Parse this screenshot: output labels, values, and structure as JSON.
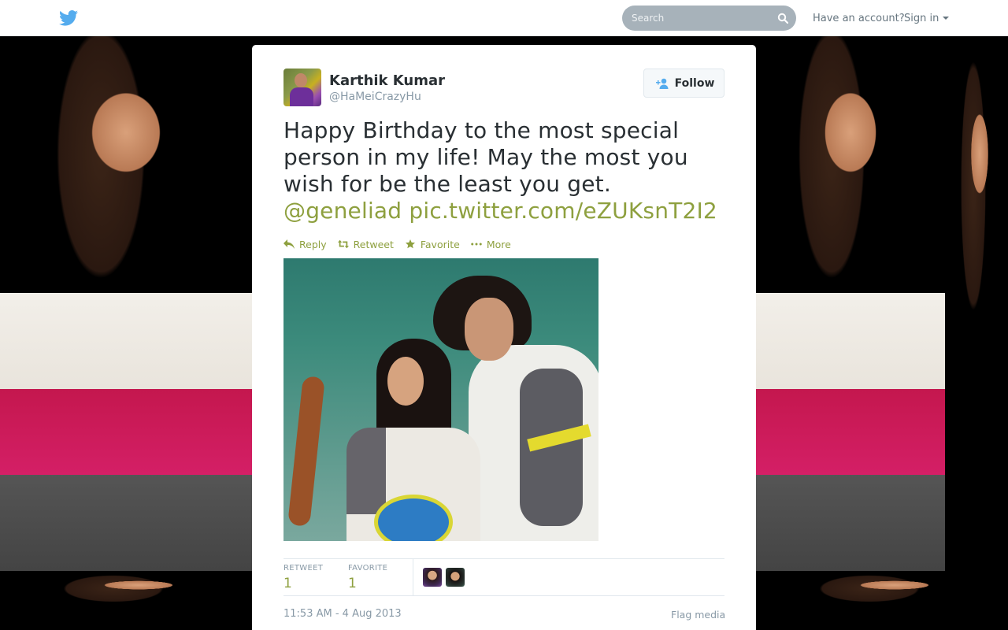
{
  "header": {
    "search": {
      "placeholder": "Search"
    },
    "have_account": "Have an account?",
    "sign_in": "Sign in"
  },
  "tweet": {
    "author": {
      "name": "Karthik Kumar",
      "handle": "@HaMeiCrazyHu"
    },
    "follow_label": "Follow",
    "text": "Happy Birthday to the most special person in my life! May the most you wish for be the least you get.",
    "mention": "@geneliad",
    "pic_link": "pic.twitter.com/eZUKsnT2I2",
    "actions": [
      {
        "label": "Reply",
        "icon": "reply-icon"
      },
      {
        "label": "Retweet",
        "icon": "retweet-icon"
      },
      {
        "label": "Favorite",
        "icon": "star-icon"
      },
      {
        "label": "More",
        "icon": "more-icon"
      }
    ],
    "stats": {
      "retweet_label": "RETWEET",
      "retweet_count": "1",
      "favorite_label": "FAVORITE",
      "favorite_count": "1"
    },
    "timestamp": "11:53 AM - 4 Aug 2013",
    "flag_label": "Flag media"
  },
  "colors": {
    "link": "#8ea03f",
    "text": "#292f33",
    "muted": "#8899a6",
    "twitter_blue": "#55acee"
  }
}
